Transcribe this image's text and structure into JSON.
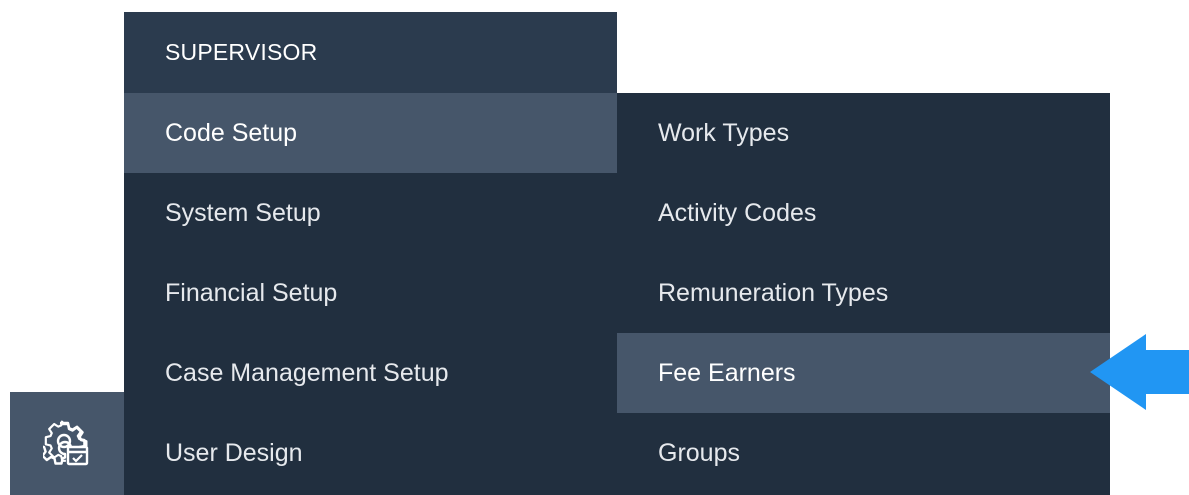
{
  "menu": {
    "header": "SUPERVISOR",
    "items": [
      {
        "label": "Code Setup",
        "active": true
      },
      {
        "label": "System Setup",
        "active": false
      },
      {
        "label": "Financial Setup",
        "active": false
      },
      {
        "label": "Case Management Setup",
        "active": false
      },
      {
        "label": "User Design",
        "active": false
      }
    ]
  },
  "submenu": {
    "items": [
      {
        "label": "Work Types",
        "active": false
      },
      {
        "label": "Activity Codes",
        "active": false
      },
      {
        "label": "Remuneration Types",
        "active": false
      },
      {
        "label": "Fee Earners",
        "active": true
      },
      {
        "label": "Groups",
        "active": false
      }
    ]
  },
  "icons": {
    "supervisor_button": "gear-calendar-icon",
    "pointer": "arrow-left-icon"
  },
  "colors": {
    "menu_bg": "#212f3f",
    "header_bg": "#2b3b4e",
    "active_bg": "#46566a",
    "arrow": "#2196f3"
  }
}
